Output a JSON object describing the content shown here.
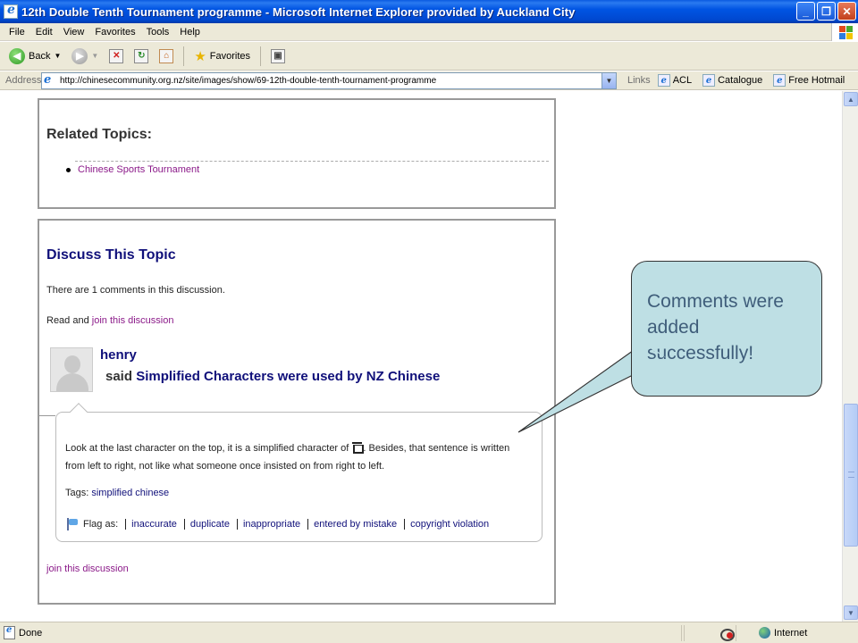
{
  "window": {
    "title": "12th Double Tenth Tournament programme - Microsoft Internet Explorer provided by Auckland City",
    "minimize": "_",
    "maximize": "❐",
    "close": "✕"
  },
  "menu": [
    "File",
    "Edit",
    "View",
    "Favorites",
    "Tools",
    "Help"
  ],
  "toolbar": {
    "back_label": "Back",
    "favorites_label": "Favorites"
  },
  "address": {
    "label": "Address",
    "url": "http://chinesecommunity.org.nz/site/images/show/69-12th-double-tenth-tournament-programme",
    "links_label": "Links",
    "links": [
      "ACL",
      "Catalogue",
      "Free Hotmail"
    ]
  },
  "related": {
    "heading": "Related Topics:",
    "items": [
      "Chinese Sports Tournament"
    ]
  },
  "discuss": {
    "heading": "Discuss This Topic",
    "count_text": "There are 1 comments in this discussion.",
    "read_prefix": "Read and ",
    "join_link": "join this discussion",
    "comment": {
      "author": "henry",
      "said": "said",
      "title": "Simplified Characters were used by NZ Chinese",
      "body_before": "Look at the last character on the top, it is a simplified character of ",
      "body_after": ". Besides, that sentence is written from left to right, not like what someone once insisted on from right to left.",
      "tags_label": "Tags:",
      "tags_value": "simplified chinese",
      "flag_label": "Flag as:",
      "flag_options": [
        "inaccurate",
        "duplicate",
        "inappropriate",
        "entered by mistake",
        "copyright violation"
      ]
    },
    "join_bottom": "join this discussion"
  },
  "callout": {
    "text": "Comments were added successfully!",
    "fill_color": "#bedfe4",
    "text_color": "#3f5d7a"
  },
  "status": {
    "left": "Done",
    "zone": "Internet"
  }
}
